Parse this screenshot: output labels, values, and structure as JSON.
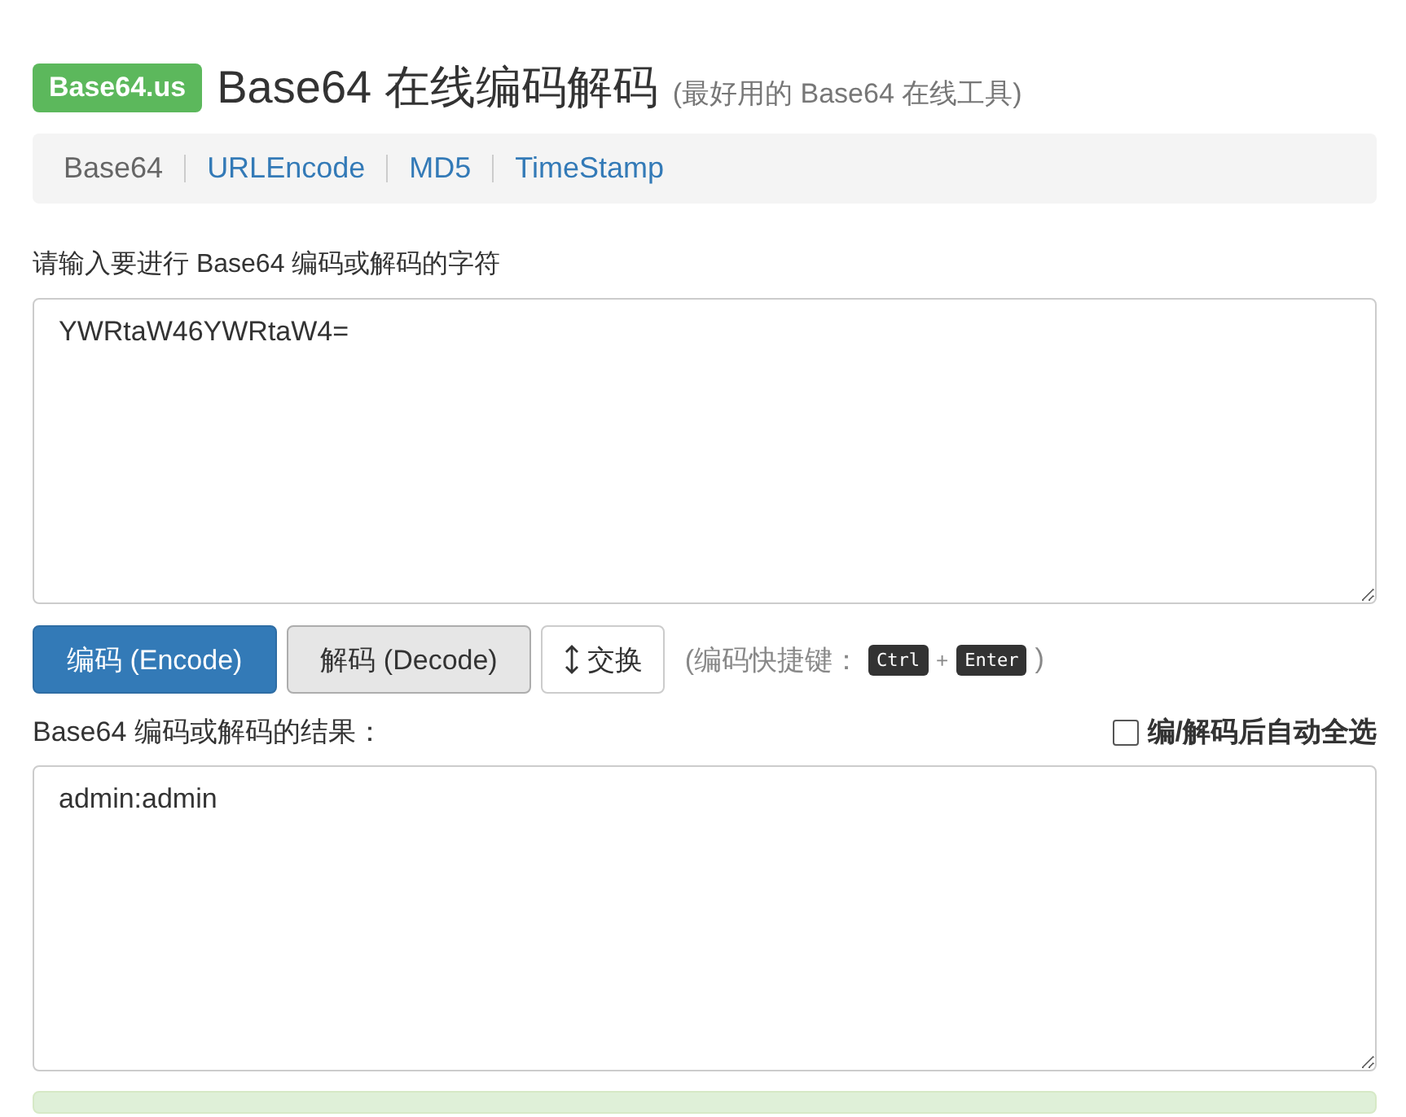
{
  "header": {
    "logo": "Base64.us",
    "title": "Base64 在线编码解码",
    "subtitle": "(最好用的 Base64 在线工具)"
  },
  "nav": [
    {
      "label": "Base64",
      "selected": true
    },
    {
      "label": "URLEncode",
      "selected": false
    },
    {
      "label": "MD5",
      "selected": false
    },
    {
      "label": "TimeStamp",
      "selected": false
    }
  ],
  "input": {
    "label": "请输入要进行 Base64 编码或解码的字符",
    "value": "YWRtaW46YWRtaW4="
  },
  "buttons": [
    {
      "kind": "primary",
      "label": "编码 (Encode)"
    },
    {
      "kind": "default",
      "label": "解码 (Decode)"
    },
    {
      "kind": "swap",
      "label": "交换"
    }
  ],
  "shortcut": {
    "prefix": "(编码快捷键：",
    "keys": [
      "Ctrl",
      "Enter"
    ],
    "plus": "+",
    "suffix": ")"
  },
  "output": {
    "label": "Base64 编码或解码的结果：",
    "value": "admin:admin"
  },
  "auto_select": {
    "label": "编/解码后自动全选",
    "checked": false
  }
}
